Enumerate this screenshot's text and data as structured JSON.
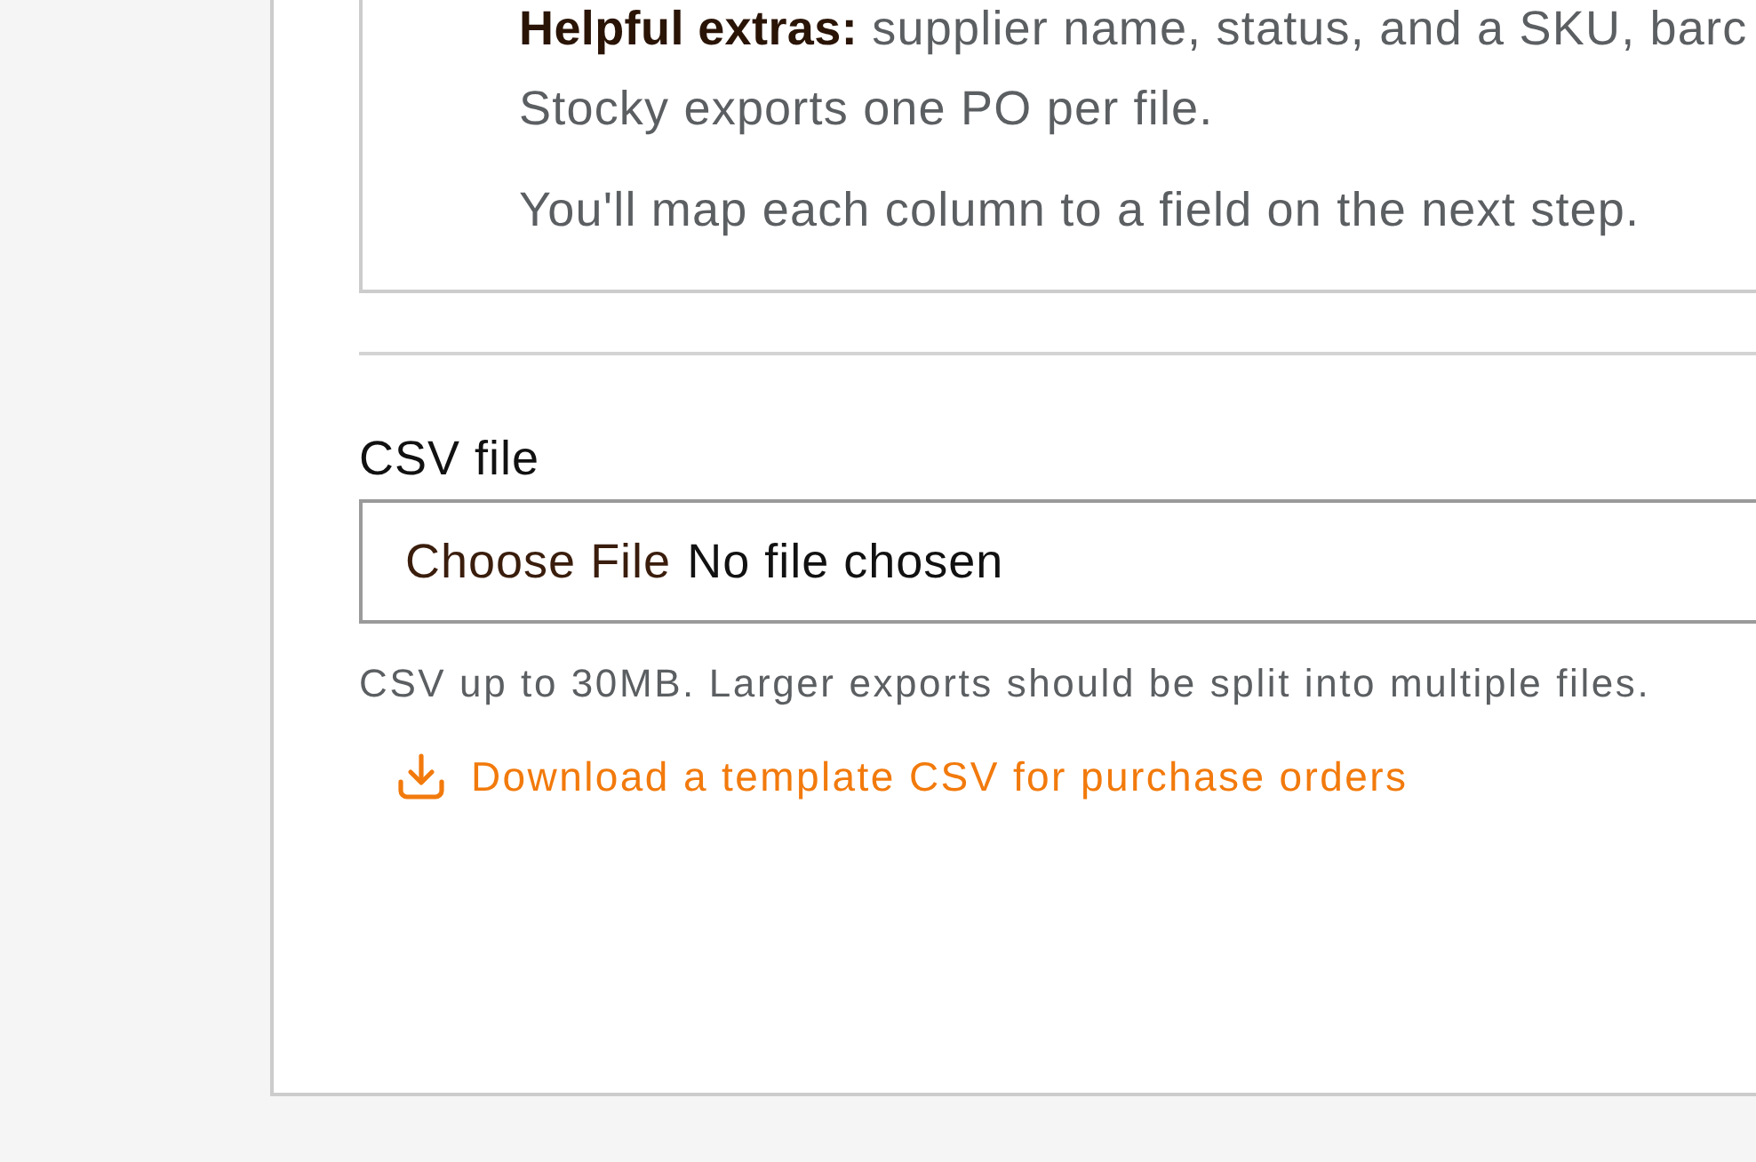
{
  "info_panel": {
    "paragraphs": [
      {
        "text": "**Helpful extras:** supplier name, status, and a SKU, barc"
      },
      {
        "text": "Stocky exports one PO per file."
      },
      {
        "text": "You'll map each column to a field on the next step."
      }
    ]
  },
  "file_field": {
    "label": "CSV file",
    "button": "Choose File",
    "value": "No file chosen",
    "help": "CSV up to 30MB. Larger exports should be split into multiple files."
  },
  "template_link": {
    "label": "Download a template CSV for purchase orders"
  }
}
